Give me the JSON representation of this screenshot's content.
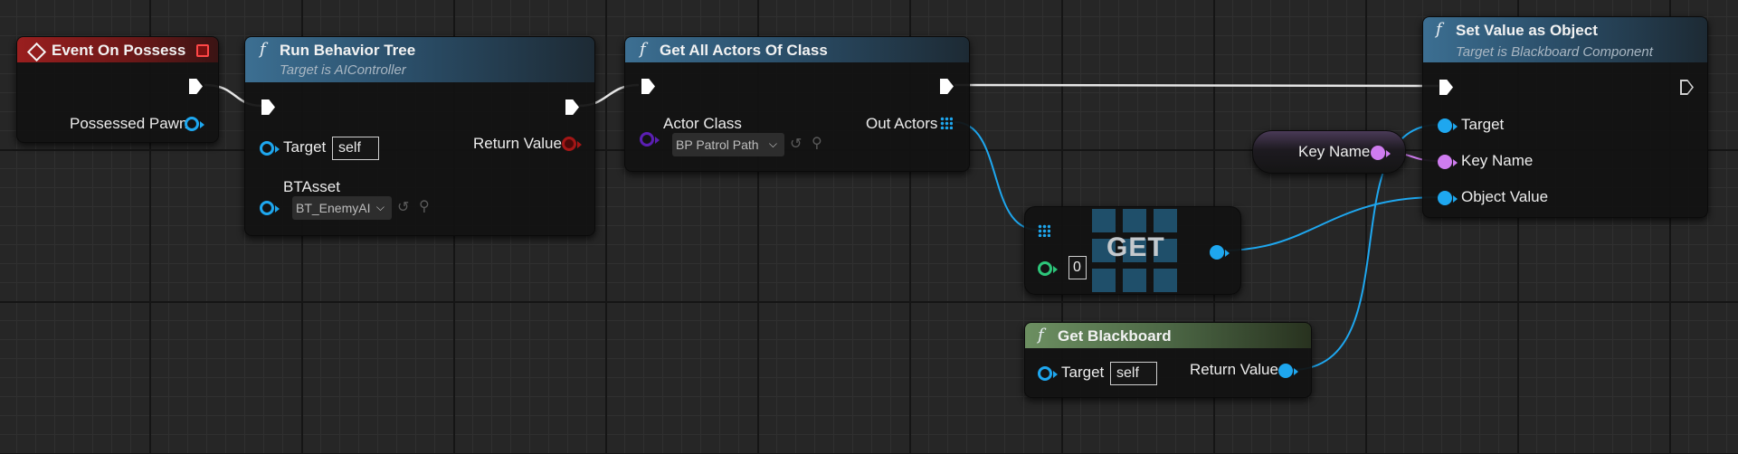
{
  "nodes": {
    "event_on_possess": {
      "title": "Event On Possess",
      "pins": {
        "possessed_pawn": "Possessed Pawn"
      }
    },
    "run_behavior_tree": {
      "title": "Run Behavior Tree",
      "subtitle": "Target is AIController",
      "pins": {
        "target": "Target",
        "target_value": "self",
        "return_value": "Return Value",
        "bt_asset": "BTAsset",
        "bt_asset_value": "BT_EnemyAI"
      }
    },
    "get_all_actors_of_class": {
      "title": "Get All Actors Of Class",
      "pins": {
        "actor_class": "Actor Class",
        "actor_class_value": "BP Patrol Path",
        "out_actors": "Out Actors"
      }
    },
    "get": {
      "title": "GET",
      "index_value": "0"
    },
    "get_blackboard": {
      "title": "Get Blackboard",
      "pins": {
        "target": "Target",
        "target_value": "self",
        "return_value": "Return Value"
      }
    },
    "key_name_var": {
      "label": "Key Name"
    },
    "set_value_as_object": {
      "title": "Set Value as Object",
      "subtitle": "Target is Blackboard Component",
      "pins": {
        "target": "Target",
        "key_name": "Key Name",
        "object_value": "Object Value"
      }
    }
  },
  "icons": {
    "function": "f",
    "dropdown": "chevron-down",
    "use_selected": "arrow-left-circle",
    "browse": "magnifier"
  },
  "colors": {
    "exec_wire": "#ffffff",
    "object_pin": "#1ea7ef",
    "name_pin": "#cf7cf0",
    "class_pin": "#5b1fb3",
    "int_pin": "#2dc67a",
    "bool_pin": "#a31616",
    "function_header": "#3c6f92",
    "event_header": "#9a1f1f",
    "pure_header": "#6c8f61"
  }
}
